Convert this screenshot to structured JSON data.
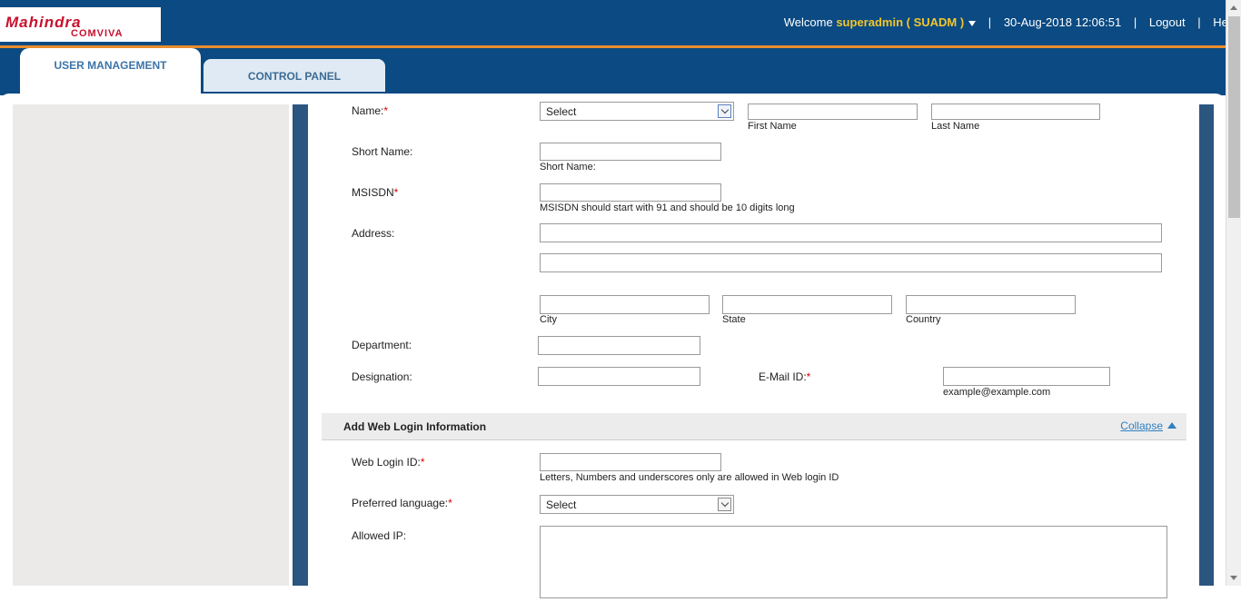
{
  "header": {
    "logo_main": "Mahindra",
    "logo_sub": "COMVIVA",
    "welcome": "Welcome",
    "username": "superadmin ( SUADM )",
    "datetime": "30-Aug-2018 12:06:51",
    "logout": "Logout",
    "help": "Help",
    "separator": "|"
  },
  "tabs": [
    {
      "label": "USER MANAGEMENT",
      "active": true
    },
    {
      "label": "CONTROL PANEL",
      "active": false
    }
  ],
  "form": {
    "name_label": "Name:",
    "name_title_select": "Select",
    "first_name_hint": "First Name",
    "last_name_hint": "Last Name",
    "short_name_label": "Short Name:",
    "short_name_hint": "Short Name:",
    "msisdn_label": "MSISDN",
    "msisdn_hint": "MSISDN should start with 91 and should be 10 digits long",
    "address_label": "Address:",
    "city_hint": "City",
    "state_hint": "State",
    "country_hint": "Country",
    "department_label": "Department:",
    "designation_label": "Designation:",
    "email_label": "E-Mail ID:",
    "email_hint": "example@example.com",
    "required_mark": "*"
  },
  "web_login": {
    "section_title": "Add Web Login Information",
    "collapse": "Collapse",
    "login_id_label": "Web Login ID:",
    "login_id_hint": "Letters, Numbers and underscores only are allowed in Web login ID",
    "language_label": "Preferred language:",
    "language_select": "Select",
    "allowed_ip_label": "Allowed IP:"
  },
  "colors": {
    "header_bg": "#0b4a82",
    "accent_orange": "#e98d2d",
    "username_yellow": "#f3c62a",
    "required_red": "#d00000",
    "link_blue": "#2f7fbf"
  }
}
